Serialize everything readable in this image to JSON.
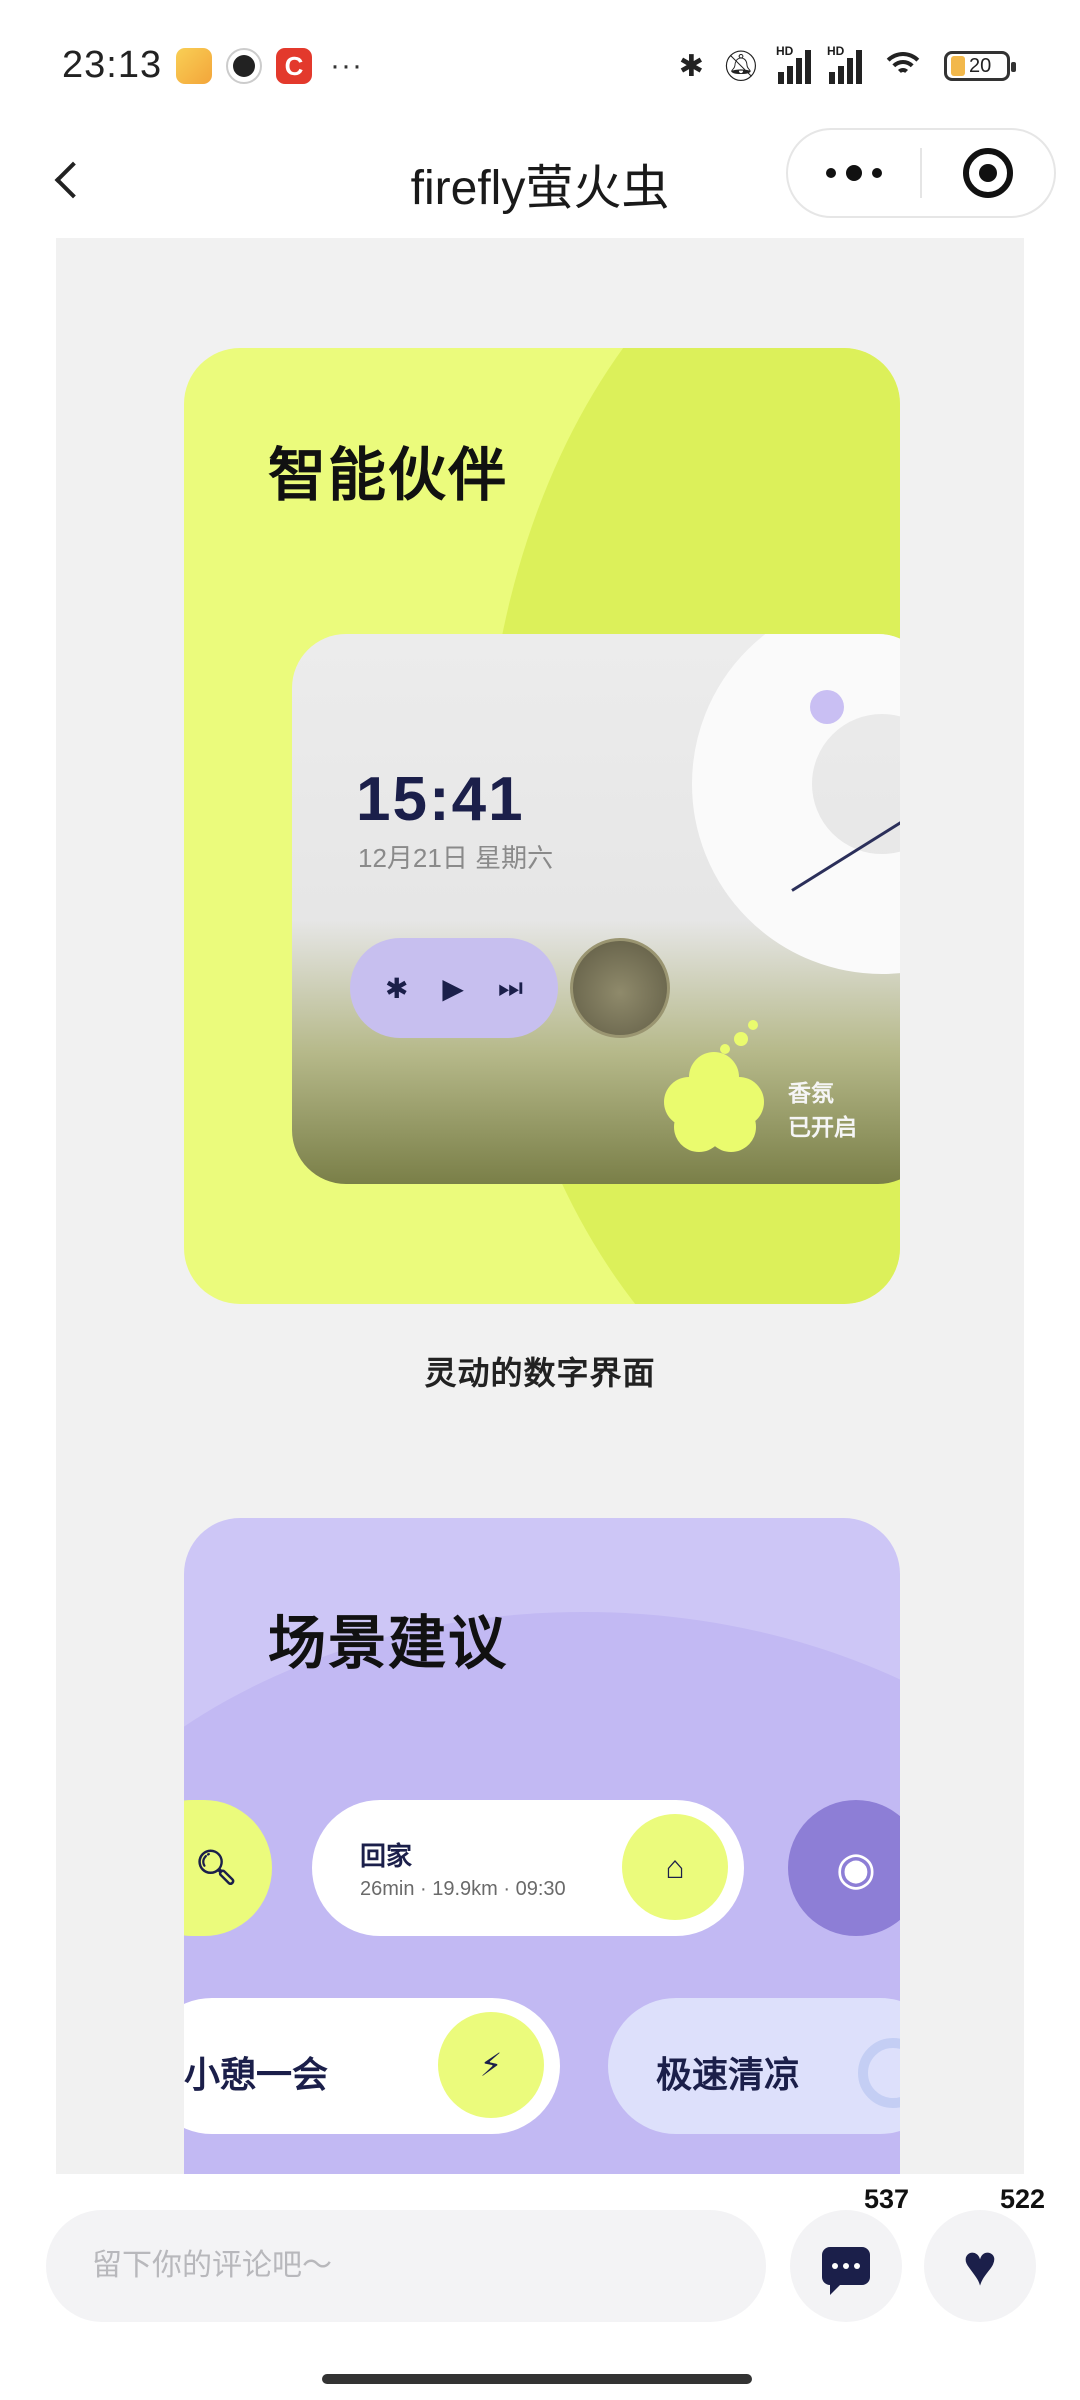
{
  "status_bar": {
    "time": "23:13",
    "more_apps": "···",
    "battery_level": "20",
    "signal_badge": "HD"
  },
  "nav": {
    "title": "firefly萤火虫"
  },
  "card1": {
    "title": "智能伙伴",
    "clock_time": "15:41",
    "clock_date": "12月21日 星期六",
    "scent_line1": "香氛",
    "scent_line2": "已开启",
    "caption": "灵动的数字界面",
    "accent_color": "#ebfb7c",
    "media_controls": [
      "bluetooth-icon",
      "play-icon",
      "next-track-icon"
    ]
  },
  "card2": {
    "title": "场景建议",
    "home_label": "回家",
    "home_sub": "26min · 19.9km · 09:30",
    "rest_label": "小憩一会",
    "cool_label": "极速清凉",
    "accent_color": "#cdc6f6"
  },
  "comment_bar": {
    "placeholder": "留下你的评论吧～",
    "comment_count": "537",
    "like_count": "522"
  }
}
